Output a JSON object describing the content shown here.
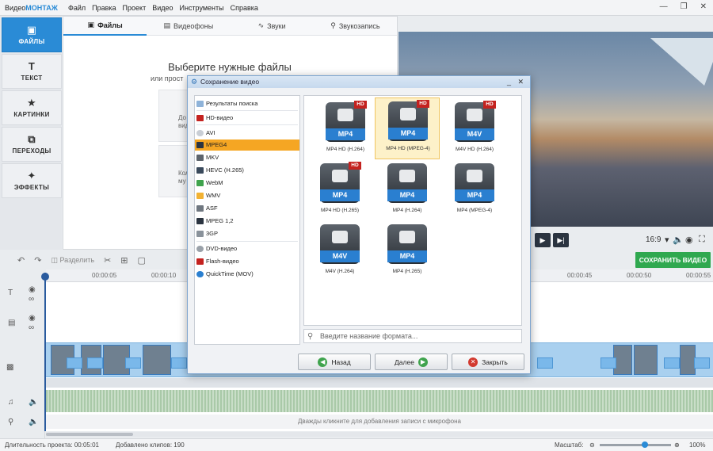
{
  "app": {
    "logo_prefix": "Видео",
    "logo_suffix": "МОНТАЖ",
    "menu": [
      "Файл",
      "Правка",
      "Проект",
      "Видео",
      "Инструменты",
      "Справка"
    ]
  },
  "nav": [
    {
      "label": "ФАЙЛЫ",
      "icon": "folder-icon",
      "active": true
    },
    {
      "label": "ТЕКСТ",
      "icon": "text-icon"
    },
    {
      "label": "КАРТИНКИ",
      "icon": "star-icon"
    },
    {
      "label": "ПЕРЕХОДЫ",
      "icon": "transitions-icon"
    },
    {
      "label": "ЭФФЕКТЫ",
      "icon": "magic-wand-icon"
    }
  ],
  "tabs": [
    "Файлы",
    "Видеофоны",
    "Звуки",
    "Звукозапись"
  ],
  "files_panel": {
    "title": "Выберите нужные файлы",
    "subtitle": "или прост",
    "card1": [
      "До",
      "виде"
    ],
    "card2": [
      "Кол",
      "му"
    ]
  },
  "preview": {
    "ratio": "16:9"
  },
  "save_video": "СОХРАНИТЬ ВИДЕО",
  "toolbar": {
    "split": "Разделить"
  },
  "ruler": [
    "00:00:05",
    "00:00:10",
    "00:00:45",
    "00:00:50",
    "00:00:55"
  ],
  "mic_hint": "Дважды кликните для добавления записи с микрофона",
  "status": {
    "duration_label": "Длительность проекта:",
    "duration": "00:05:01",
    "clips_label": "Добавлено клипов:",
    "clips": "190",
    "zoom_label": "Масштаб:",
    "zoom": "100%"
  },
  "dialog": {
    "title": "Сохранение видео",
    "formats": [
      {
        "label": "Результаты поиска"
      },
      {
        "label": "HD-видео"
      },
      {
        "label": "AVI"
      },
      {
        "label": "MPEG4",
        "selected": true
      },
      {
        "label": "MKV"
      },
      {
        "label": "HEVC (H.265)"
      },
      {
        "label": "WebM"
      },
      {
        "label": "WMV"
      },
      {
        "label": "ASF"
      },
      {
        "label": "MPEG 1,2"
      },
      {
        "label": "3GP"
      },
      {
        "label": "DVD-видео"
      },
      {
        "label": "Flash-видео"
      },
      {
        "label": "QuickTime (MOV)"
      }
    ],
    "presets": [
      {
        "badge": "MP4",
        "hd": true,
        "name": "MP4 HD (H.264)"
      },
      {
        "badge": "MP4",
        "hd": true,
        "name": "MP4 HD (MPEG-4)",
        "selected": true
      },
      {
        "badge": "M4V",
        "hd": true,
        "name": "M4V HD (H.264)"
      },
      {
        "badge": "MP4",
        "hd": true,
        "name": "MP4 HD (H.265)"
      },
      {
        "badge": "MP4",
        "hd": false,
        "name": "MP4 (H.264)"
      },
      {
        "badge": "MP4",
        "hd": false,
        "name": "MP4 (MPEG-4)"
      },
      {
        "badge": "M4V",
        "hd": false,
        "name": "M4V (H.264)"
      },
      {
        "badge": "MP4",
        "hd": false,
        "name": "MP4 (H.265)"
      }
    ],
    "hd_label": "HD",
    "search_placeholder": "Введите название формата...",
    "back": "Назад",
    "next": "Далее",
    "close": "Закрыть"
  }
}
